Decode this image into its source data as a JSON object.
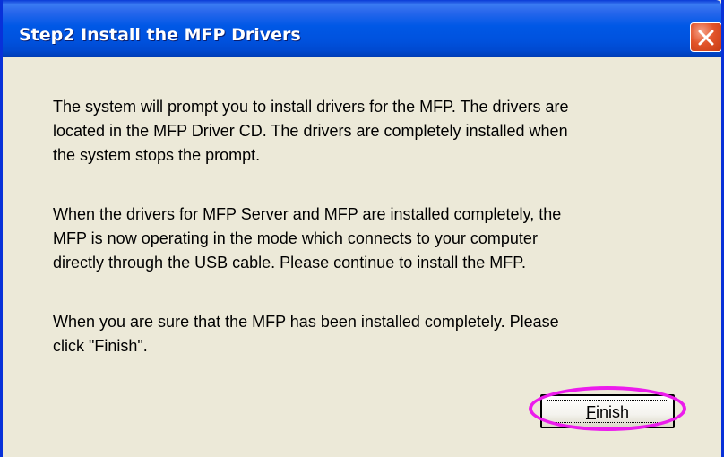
{
  "window": {
    "title": "Step2 Install the MFP Drivers",
    "close_icon": "close-icon"
  },
  "content": {
    "paragraphs": [
      "The system will prompt you to install drivers for the MFP. The drivers are\nlocated in the MFP Driver CD. The drivers are completely installed when\nthe system stops the prompt.",
      " When the drivers for MFP Server and MFP are installed completely, the\nMFP is now operating in the mode which connects to your computer\ndirectly through the USB cable. Please continue to install the MFP.",
      " When you are sure that the MFP has been installed completely. Please\nclick \"Finish\"."
    ]
  },
  "buttons": {
    "finish": {
      "accelerator": "F",
      "rest": "inish"
    }
  },
  "annotation": {
    "highlight_color": "#ec1cec"
  },
  "colors": {
    "titlebar": "#0058e6",
    "dialog_face": "#ece9d8",
    "close_button": "#e2542a"
  }
}
